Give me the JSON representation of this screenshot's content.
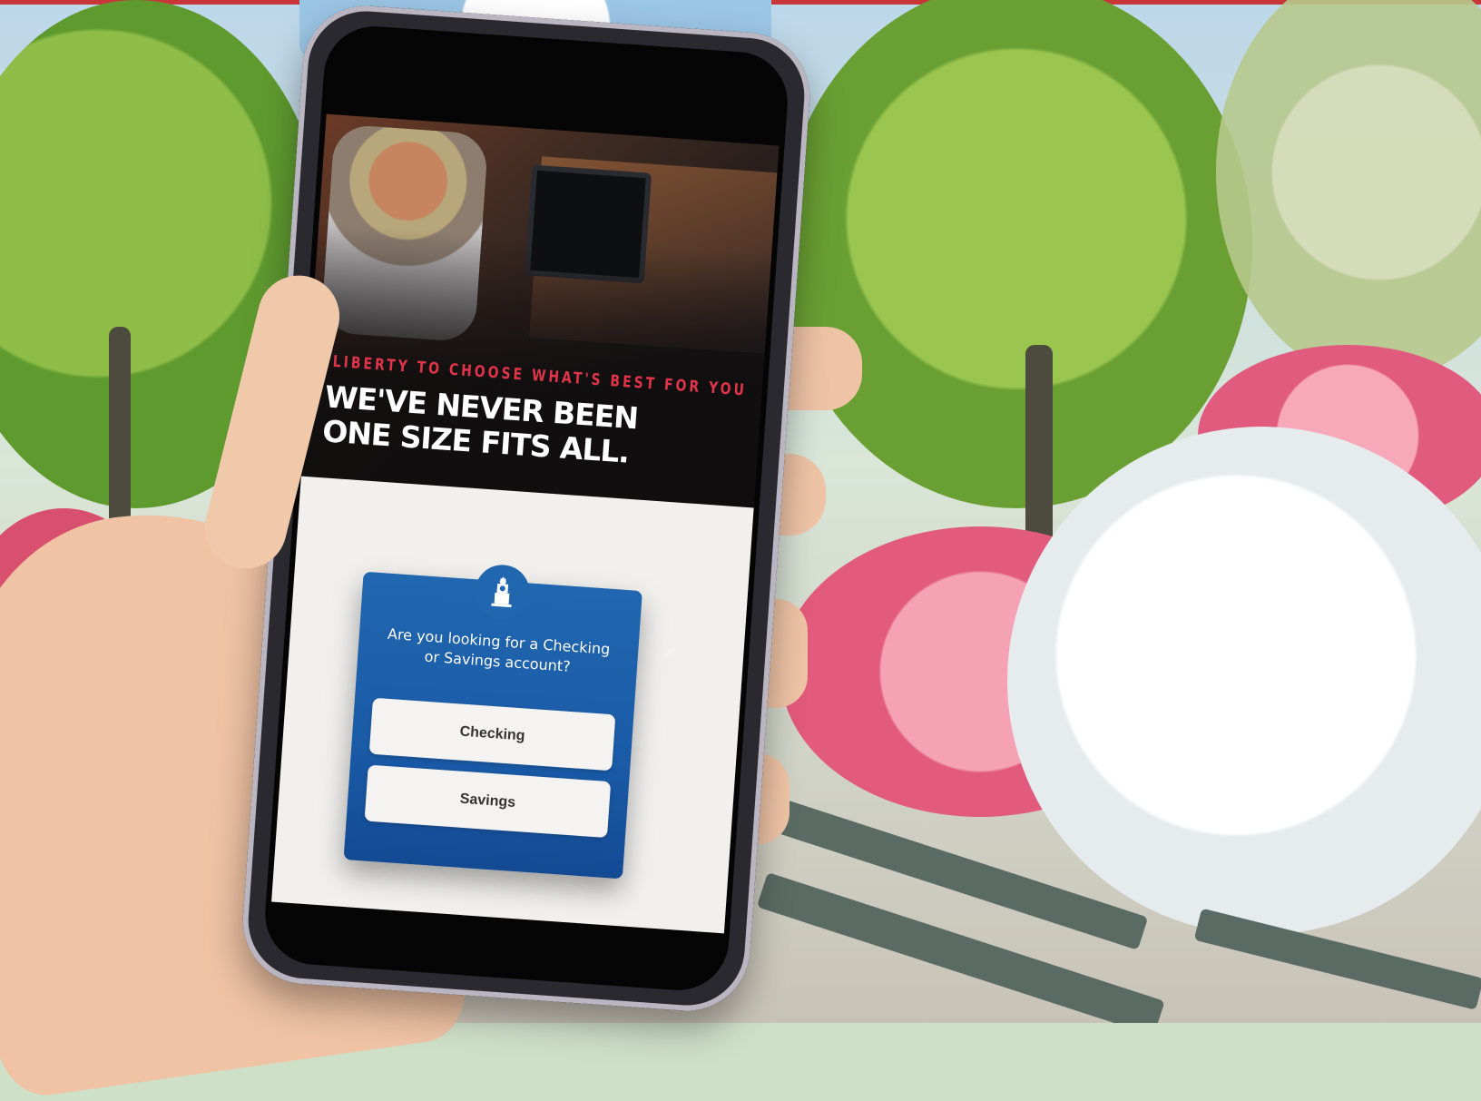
{
  "hero": {
    "tagline": "LIBERTY TO CHOOSE WHAT'S BEST FOR YOU",
    "headline": "WE'VE NEVER BEEN ONE SIZE FITS ALL."
  },
  "popup": {
    "question": "Are you looking for a Checking or Savings account?",
    "close_symbol": "×",
    "icon": "clock-tower-icon",
    "options": [
      "Checking",
      "Savings"
    ]
  },
  "colors": {
    "accent_red": "#e0344a",
    "popup_blue": "#1f63ad",
    "top_bar": "#c8363a"
  }
}
